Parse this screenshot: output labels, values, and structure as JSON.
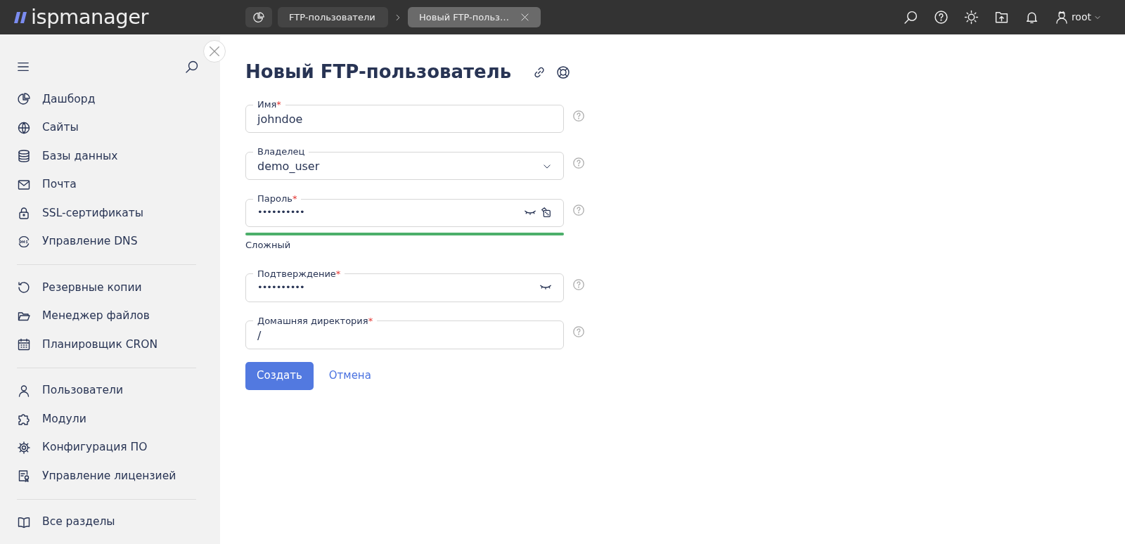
{
  "header": {
    "logo": "ispmanager",
    "breadcrumbs": [
      {
        "label": "FTP-пользователи",
        "selected": false
      },
      {
        "label": "Новый FTP-польз…",
        "selected": true
      }
    ],
    "user": "root"
  },
  "sidebar": {
    "groups": [
      {
        "items": [
          "Дашборд",
          "Сайты",
          "Базы данных",
          "Почта",
          "SSL-сертификаты",
          "Управление DNS"
        ]
      },
      {
        "items": [
          "Резервные копии",
          "Менеджер файлов",
          "Планировщик CRON"
        ]
      },
      {
        "items": [
          "Пользователи",
          "Модули",
          "Конфигурация ПО",
          "Управление лицензией"
        ]
      },
      {
        "items": [
          "Все разделы"
        ]
      }
    ]
  },
  "form": {
    "title": "Новый FTP-пользователь",
    "fields": [
      {
        "kind": "text",
        "label": "Имя",
        "required_mark": "*",
        "value": "johndoe"
      },
      {
        "kind": "select",
        "label": "Владелец",
        "value": "demo_user"
      },
      {
        "kind": "password",
        "label": "Пароль",
        "required_mark": "*",
        "value": "••••••••••",
        "generator": true,
        "strength": {
          "level": 1,
          "color": "#4caf6a",
          "label": "Сложный"
        }
      },
      {
        "kind": "password",
        "label": "Подтверждение",
        "required_mark": "*",
        "value": "••••••••••",
        "generator": false
      },
      {
        "kind": "text",
        "label": "Домашняя директория",
        "required_mark": "*",
        "value": "/"
      }
    ],
    "buttons": [
      {
        "kind": "primary",
        "label": "Создать"
      },
      {
        "kind": "link",
        "label": "Отмена"
      }
    ]
  }
}
